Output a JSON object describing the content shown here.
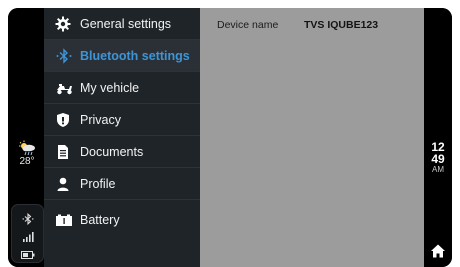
{
  "status": {
    "temperature": "28°",
    "weather_icon": "partly-cloudy-rain-icon",
    "bluetooth_icon": "bluetooth-icon",
    "signal_icon": "signal-bars-icon",
    "battery_icon": "battery-icon"
  },
  "menu": {
    "items": [
      {
        "label": "General settings",
        "icon": "gear-icon",
        "active": false
      },
      {
        "label": "Bluetooth settings",
        "icon": "bluetooth-icon",
        "active": true
      },
      {
        "label": "My vehicle",
        "icon": "scooter-icon",
        "active": false
      },
      {
        "label": "Privacy",
        "icon": "shield-icon",
        "active": false
      },
      {
        "label": "Documents",
        "icon": "document-icon",
        "active": false
      },
      {
        "label": "Profile",
        "icon": "person-icon",
        "active": false
      },
      {
        "label": "Battery",
        "icon": "battery-icon",
        "active": false
      }
    ]
  },
  "content": {
    "device_name_label": "Device name",
    "device_name_value": "TVS IQUBE123"
  },
  "clock": {
    "hour": "12",
    "minute": "49",
    "ampm": "AM"
  },
  "nav": {
    "home_icon": "home-icon"
  },
  "colors": {
    "accent": "#3d95d8",
    "menu_bg": "#1f2428",
    "content_bg": "#9c9c9c"
  }
}
